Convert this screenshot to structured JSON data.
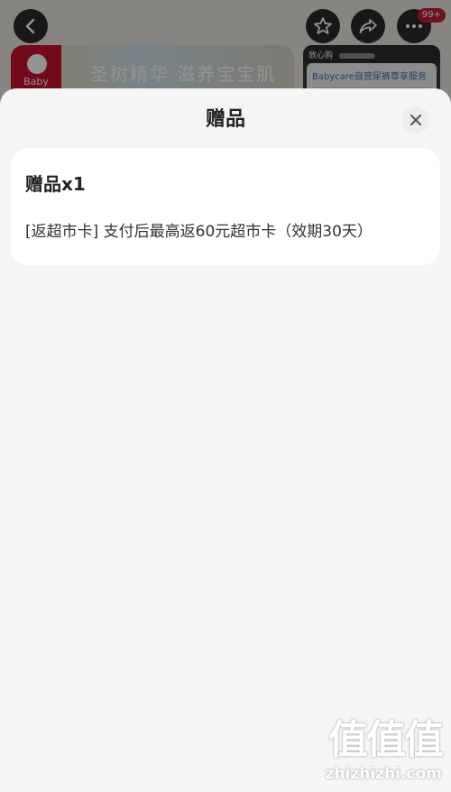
{
  "background": {
    "banner_slogan": "圣树精华 滋养宝宝肌",
    "logo_text": "Baby",
    "card_header": "放心购",
    "card_title": "Babycare自营尿裤尊享服务",
    "more_badge": "99+"
  },
  "sheet": {
    "title": "赠品",
    "close_icon": "close-icon",
    "gift": {
      "heading": "赠品x1",
      "description": "[返超市卡] 支付后最高返60元超市卡（效期30天）"
    }
  },
  "watermark": {
    "logo": "值值值",
    "url": "zhizhizhi.com"
  },
  "colors": {
    "sheet_bg": "#f5f5f5",
    "card_bg": "#ffffff",
    "badge": "#c0203a"
  }
}
